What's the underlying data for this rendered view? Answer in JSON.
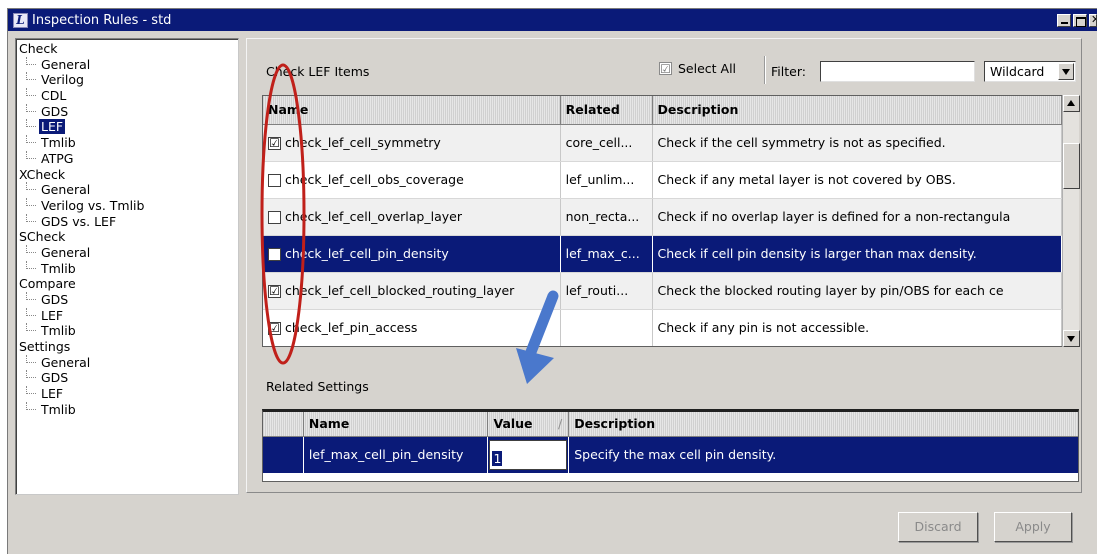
{
  "window": {
    "title": "Inspection Rules - std",
    "app_icon_glyph": "L"
  },
  "tree": {
    "groups": [
      {
        "label": "Check",
        "children": [
          "General",
          "Verilog",
          "CDL",
          "GDS",
          "LEF",
          "Tmlib",
          "ATPG"
        ]
      },
      {
        "label": "XCheck",
        "children": [
          "General",
          "Verilog vs. Tmlib",
          "GDS vs. LEF"
        ]
      },
      {
        "label": "SCheck",
        "children": [
          "General",
          "Tmlib"
        ]
      },
      {
        "label": "Compare",
        "children": [
          "GDS",
          "LEF",
          "Tmlib"
        ]
      },
      {
        "label": "Settings",
        "children": [
          "General",
          "GDS",
          "LEF",
          "Tmlib"
        ]
      }
    ]
  },
  "main": {
    "items_title": "Check LEF Items",
    "select_all_label": "Select All",
    "select_all_mark": "☑",
    "filter_label": "Filter:",
    "filter_value": "",
    "filter_mode": "Wildcard",
    "columns": {
      "name": "Name",
      "related": "Related",
      "description": "Description"
    },
    "rows": [
      {
        "mark": "☑",
        "name": "check_lef_cell_symmetry",
        "related": "core_cell...",
        "description": "Check if the cell symmetry is not as specified."
      },
      {
        "mark": "",
        "name": "check_lef_cell_obs_coverage",
        "related": "lef_unlim...",
        "description": "Check if any metal layer is not covered by OBS."
      },
      {
        "mark": "",
        "name": "check_lef_cell_overlap_layer",
        "related": "non_recta...",
        "description": "Check if no overlap layer is defined for a non-rectangula"
      },
      {
        "mark": "☑",
        "name": "check_lef_cell_pin_density",
        "related": "lef_max_c...",
        "description": "Check if cell pin density is larger than max density."
      },
      {
        "mark": "☑",
        "name": "check_lef_cell_blocked_routing_layer",
        "related": "lef_routi...",
        "description": "Check the blocked routing layer by pin/OBS for each ce"
      },
      {
        "mark": "☑",
        "name": "check_lef_pin_access",
        "related": "",
        "description": "Check if any pin is not accessible."
      }
    ],
    "selected_row": 3
  },
  "related": {
    "title": "Related Settings",
    "columns": {
      "name": "Name",
      "value": "Value",
      "sort": "/",
      "description": "Description"
    },
    "rows": [
      {
        "name": "lef_max_cell_pin_density",
        "value": "1",
        "description": "Specify the max cell pin density."
      }
    ]
  },
  "buttons": {
    "discard": "Discard",
    "apply": "Apply"
  },
  "colors": {
    "selection": "#0a1a78",
    "annotation_ellipse": "#c0201a",
    "annotation_arrow": "#4a78cc"
  }
}
